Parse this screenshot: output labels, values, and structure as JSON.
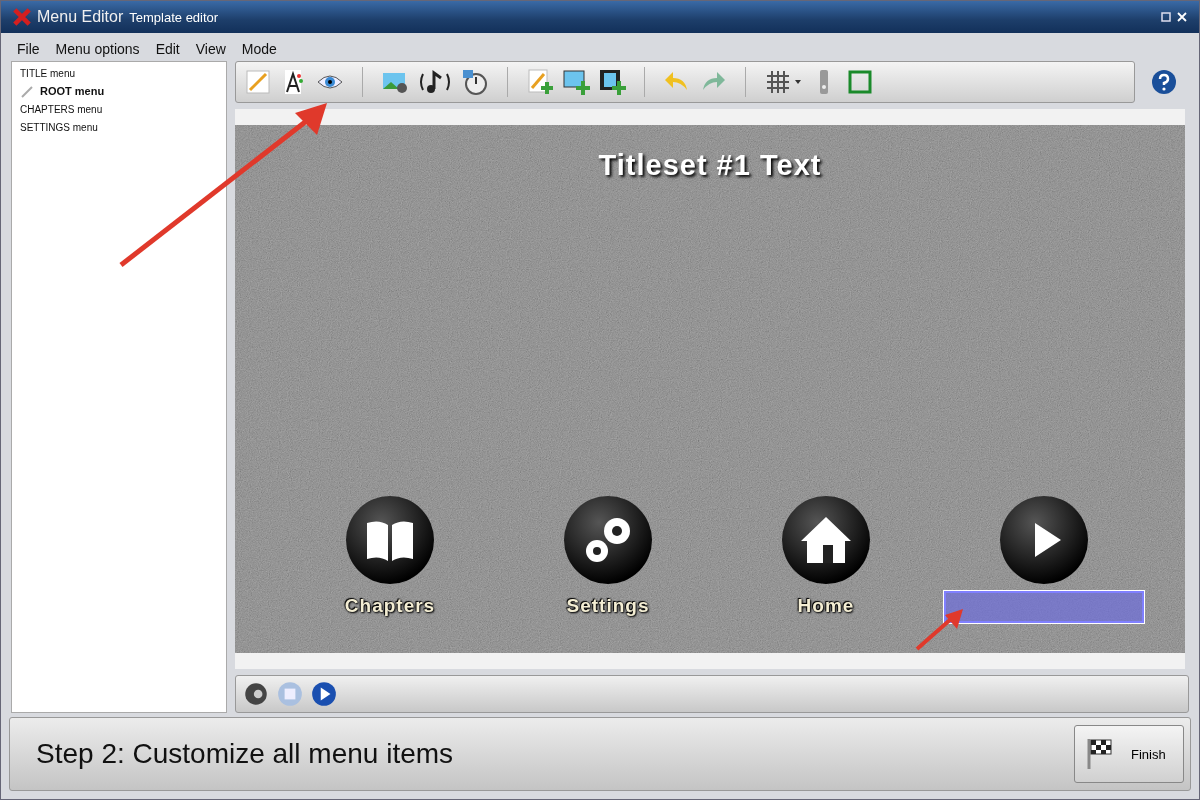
{
  "window": {
    "title": "Menu Editor",
    "subtitle": "Template editor"
  },
  "menu_bar": [
    "File",
    "Menu options",
    "Edit",
    "View",
    "Mode"
  ],
  "menu_tree": [
    {
      "label": "TITLE menu",
      "selected": false
    },
    {
      "label": "ROOT menu",
      "selected": true
    },
    {
      "label": "CHAPTERS menu",
      "selected": false
    },
    {
      "label": "SETTINGS menu",
      "selected": false
    }
  ],
  "canvas": {
    "title": "Titleset #1 Text",
    "buttons": [
      {
        "kind": "book",
        "label": "Chapters",
        "selected": false
      },
      {
        "kind": "gears",
        "label": "Settings",
        "selected": false
      },
      {
        "kind": "house",
        "label": "Home",
        "selected": false
      },
      {
        "kind": "play",
        "selected": true
      }
    ]
  },
  "footer": {
    "step": "Step 2: Customize all menu items",
    "finish_button": "Finish"
  }
}
